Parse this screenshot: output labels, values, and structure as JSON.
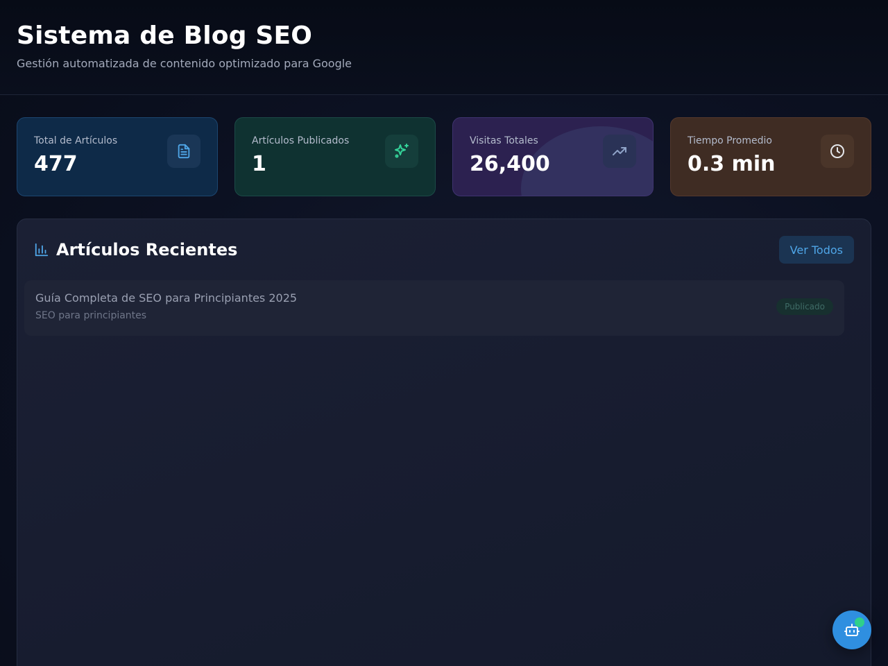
{
  "header": {
    "title": "Sistema de Blog SEO",
    "subtitle": "Gestión automatizada de contenido optimizado para Google"
  },
  "stats": [
    {
      "label": "Total de Artículos",
      "value": "477",
      "icon": "document-icon",
      "accent": "#4fa6e8"
    },
    {
      "label": "Artículos Publicados",
      "value": "1",
      "icon": "sparkles-icon",
      "accent": "#34d399"
    },
    {
      "label": "Visitas Totales",
      "value": "26,400",
      "icon": "trending-up-icon",
      "accent": "#8fa3c8"
    },
    {
      "label": "Tiempo Promedio",
      "value": "0.3 min",
      "icon": "clock-icon",
      "accent": "#e5e7eb"
    }
  ],
  "recent": {
    "title": "Artículos Recientes",
    "view_all_label": "Ver Todos",
    "icon": "bar-chart-icon",
    "articles": [
      {
        "title": "Guía Completa de SEO para Principiantes 2025",
        "keyword": "SEO para principiantes",
        "status": "Publicado"
      }
    ]
  },
  "fab": {
    "icon": "robot-icon",
    "status_color": "#2fd08a"
  }
}
